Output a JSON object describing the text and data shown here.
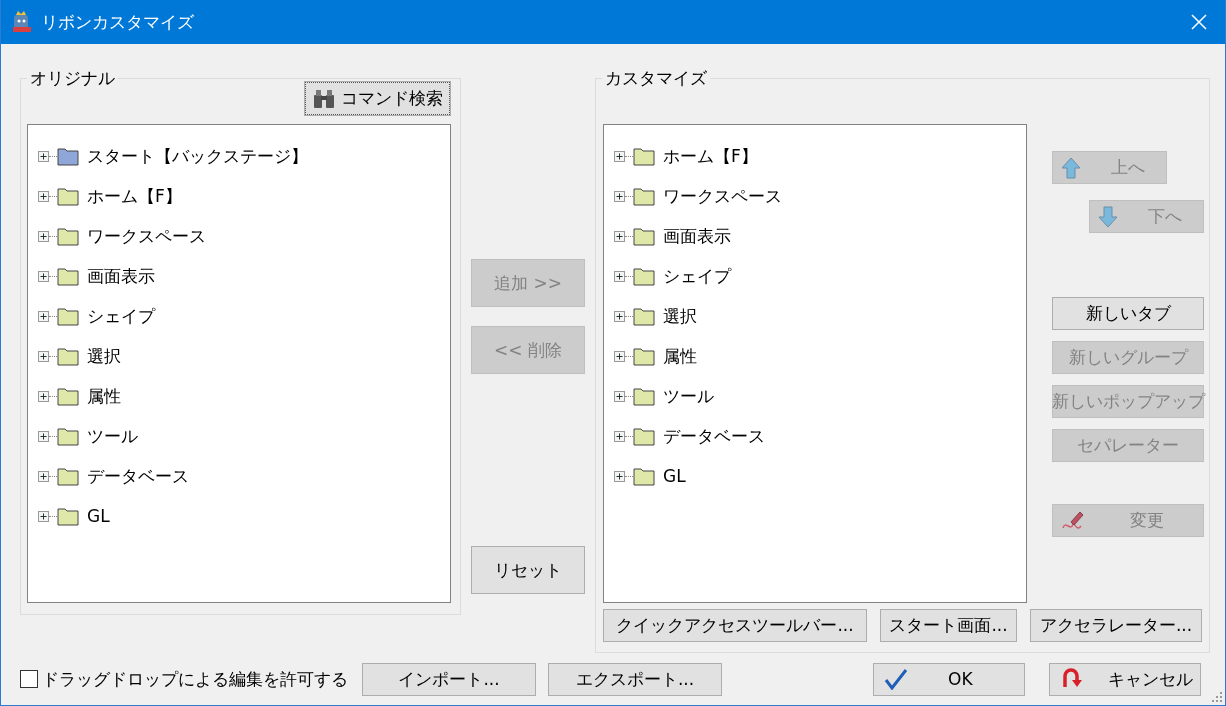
{
  "window": {
    "title": "リボンカスタマイズ"
  },
  "original": {
    "title": "オリジナル",
    "search_button": "コマンド検索",
    "items": [
      {
        "label": "スタート【バックステージ】",
        "color": "#8fa6d8",
        "expanded": false
      },
      {
        "label": "ホーム【F】",
        "color": "#dfe8a8",
        "expanded": false
      },
      {
        "label": "ワークスペース",
        "color": "#dfe8a8",
        "expanded": false
      },
      {
        "label": "画面表示",
        "color": "#dfe8a8",
        "expanded": false
      },
      {
        "label": "シェイプ",
        "color": "#dfe8a8",
        "expanded": false
      },
      {
        "label": "選択",
        "color": "#dfe8a8",
        "expanded": false
      },
      {
        "label": "属性",
        "color": "#dfe8a8",
        "expanded": false
      },
      {
        "label": "ツール",
        "color": "#dfe8a8",
        "expanded": false
      },
      {
        "label": "データベース",
        "color": "#dfe8a8",
        "expanded": false
      },
      {
        "label": "GL",
        "color": "#dfe8a8",
        "expanded": false
      }
    ]
  },
  "middle_buttons": [
    {
      "label": "追加 >>",
      "disabled": true
    },
    {
      "label": "<< 削除",
      "disabled": true
    },
    {
      "label": "リセット",
      "disabled": false
    }
  ],
  "customize": {
    "title": "カスタマイズ",
    "items": [
      {
        "label": "ホーム【F】",
        "color": "#dfe8a8",
        "expanded": false
      },
      {
        "label": "ワークスペース",
        "color": "#dfe8a8",
        "expanded": false
      },
      {
        "label": "画面表示",
        "color": "#dfe8a8",
        "expanded": false
      },
      {
        "label": "シェイプ",
        "color": "#dfe8a8",
        "expanded": false
      },
      {
        "label": "選択",
        "color": "#dfe8a8",
        "expanded": false
      },
      {
        "label": "属性",
        "color": "#dfe8a8",
        "expanded": false
      },
      {
        "label": "ツール",
        "color": "#dfe8a8",
        "expanded": false
      },
      {
        "label": "データベース",
        "color": "#dfe8a8",
        "expanded": false
      },
      {
        "label": "GL",
        "color": "#dfe8a8",
        "expanded": false
      }
    ],
    "side_buttons": [
      {
        "kind": "up",
        "label": "上へ",
        "disabled": true
      },
      {
        "kind": "down",
        "label": "下へ",
        "disabled": true
      },
      {
        "kind": "plain",
        "label": "新しいタブ",
        "disabled": false
      },
      {
        "kind": "plain",
        "label": "新しいグループ",
        "disabled": true
      },
      {
        "kind": "plain",
        "label": "新しいポップアップ",
        "disabled": true
      },
      {
        "kind": "plain",
        "label": "セパレーター",
        "disabled": true
      },
      {
        "kind": "edit",
        "label": "変更",
        "disabled": true
      }
    ],
    "bottom_buttons": [
      "クイックアクセスツールバー...",
      "スタート画面...",
      "アクセラレーター..."
    ]
  },
  "drag_drop": {
    "label": "ドラッグドロップによる編集を許可する",
    "checked": false
  },
  "footer_buttons": [
    "インポート...",
    "エクスポート..."
  ],
  "ok": "OK",
  "cancel": "キャンセル"
}
